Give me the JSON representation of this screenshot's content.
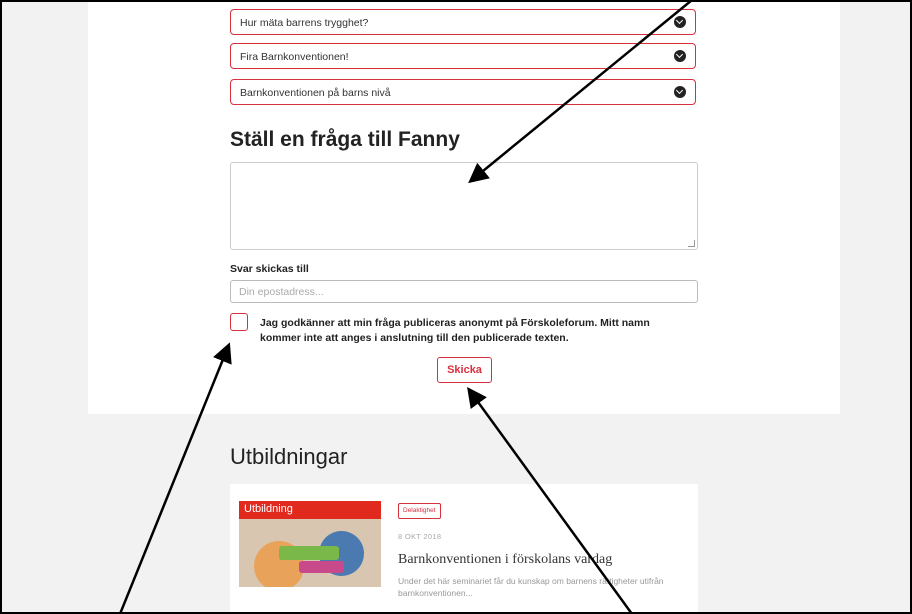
{
  "accordion": [
    {
      "label": "Hur mäta barrens trygghet?"
    },
    {
      "label": "Fira Barnkonventionen!"
    },
    {
      "label": "Barnkonventionen på barns nivå"
    }
  ],
  "form": {
    "heading": "Ställ en fråga till Fanny",
    "recipient_label": "Svar skickas till",
    "email_placeholder": "Din epostadress...",
    "consent_text": "Jag godkänner att min fråga publiceras anonymt på Förskoleforum. Mitt namn kommer inte att anges i anslutning till den publicerade texten.",
    "submit_label": "Skicka"
  },
  "trainings": {
    "heading": "Utbildningar",
    "card": {
      "thumbnail_label": "Utbildning",
      "tag": "Delaktighet",
      "date": "8 OKT 2018",
      "title": "Barnkonventionen i förskolans vardag",
      "description": "Under det här seminariet får du kunskap om barnens rättigheter utifrån barnkonventionen..."
    }
  },
  "colors": {
    "accent": "#d9303e",
    "band": "#e02a1e",
    "page_bg": "#f2f2f2"
  }
}
